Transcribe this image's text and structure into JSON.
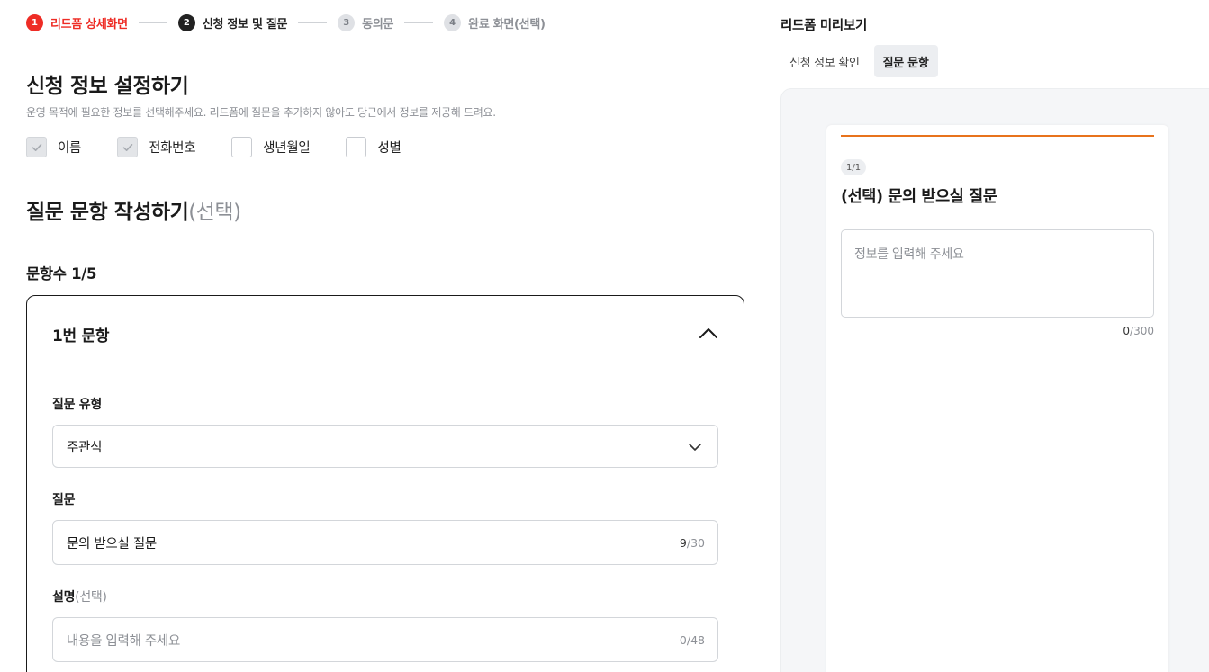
{
  "stepper": {
    "steps": [
      {
        "num": "1",
        "label": "리드폼 상세화면",
        "state": "done"
      },
      {
        "num": "2",
        "label": "신청 정보 및 질문",
        "state": "active"
      },
      {
        "num": "3",
        "label": "동의문",
        "state": "todo"
      },
      {
        "num": "4",
        "label": "완료 화면(선택)",
        "state": "todo"
      }
    ]
  },
  "info_section": {
    "title": "신청 정보 설정하기",
    "description": "운영 목적에 필요한 정보를 선택해주세요. 리드폼에 질문을 추가하지 않아도 당근에서 정보를 제공해 드려요.",
    "fields": [
      {
        "label": "이름",
        "checked": true
      },
      {
        "label": "전화번호",
        "checked": true
      },
      {
        "label": "생년월일",
        "checked": false
      },
      {
        "label": "성별",
        "checked": false
      }
    ]
  },
  "question_section": {
    "title": "질문 문항 작성하기",
    "title_optional": "(선택)",
    "count_label": "문항수 1/5",
    "card": {
      "title": "1번 문항",
      "type_label": "질문 유형",
      "type_value": "주관식",
      "question_label": "질문",
      "question_value": "문의 받으실 질문",
      "question_count_current": "9",
      "question_count_max": "/30",
      "desc_label": "설명",
      "desc_optional": "(선택)",
      "desc_placeholder": "내용을 입력해 주세요",
      "desc_count_current": "0",
      "desc_count_max": "/48"
    }
  },
  "preview": {
    "title": "리드폼 미리보기",
    "tabs": [
      {
        "label": "신청 정보 확인",
        "selected": false
      },
      {
        "label": "질문 문항",
        "selected": true
      }
    ],
    "page_indicator": "1/1",
    "question_title": "(선택) 문의 받으실 질문",
    "input_placeholder": "정보를 입력해 주세요",
    "count_current": "0",
    "count_max": "/300",
    "accent_color": "#e8731c"
  },
  "colors": {
    "done": "#ee2c25",
    "active": "#222222",
    "todo": "#dfe1e5"
  }
}
